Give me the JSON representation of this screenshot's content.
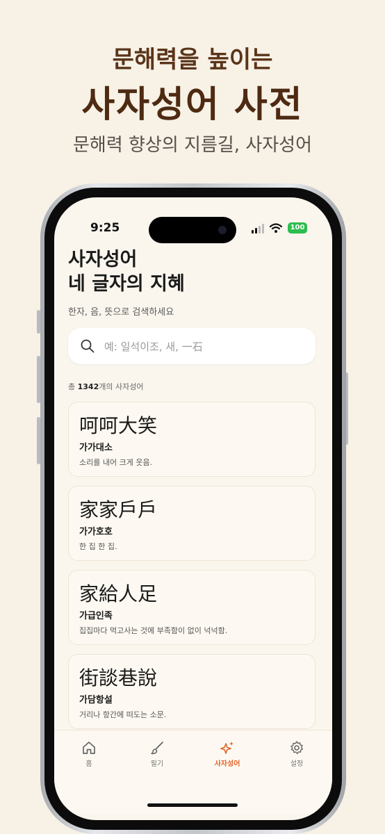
{
  "promo": {
    "subtitle": "문해력을 높이는",
    "title": "사자성어 사전",
    "tagline": "문해력 향상의 지름길, 사자성어"
  },
  "status_bar": {
    "time": "9:25",
    "battery": "100"
  },
  "header": {
    "title_line1": "사자성어",
    "title_line2": "네 글자의 지혜",
    "hint": "한자, 음, 뜻으로 검색하세요"
  },
  "search": {
    "placeholder": "예: 일석이조, 새, 一石",
    "value": ""
  },
  "count": {
    "prefix": "총 ",
    "number": "1342",
    "suffix": "개의 사자성어"
  },
  "idioms": [
    {
      "hanja": "呵呵大笑",
      "reading": "가가대소",
      "meaning": "소리를 내어 크게 웃음."
    },
    {
      "hanja": "家家戶戶",
      "reading": "가가호호",
      "meaning": "한 집 한 집."
    },
    {
      "hanja": "家給人足",
      "reading": "가급인족",
      "meaning": "집집마다 먹고사는 것에 부족함이 없이 넉넉함."
    },
    {
      "hanja": "街談巷說",
      "reading": "가담항설",
      "meaning": "거리나 항간에 떠도는 소문."
    }
  ],
  "tabs": [
    {
      "label": "홈",
      "icon": "home-icon"
    },
    {
      "label": "필기",
      "icon": "brush-icon"
    },
    {
      "label": "사자성어",
      "icon": "sparkles-icon",
      "active": true
    },
    {
      "label": "설정",
      "icon": "gear-icon"
    }
  ],
  "colors": {
    "accent": "#e0642a",
    "brand_brown": "#4e2a12",
    "background": "#f7f1e6"
  }
}
